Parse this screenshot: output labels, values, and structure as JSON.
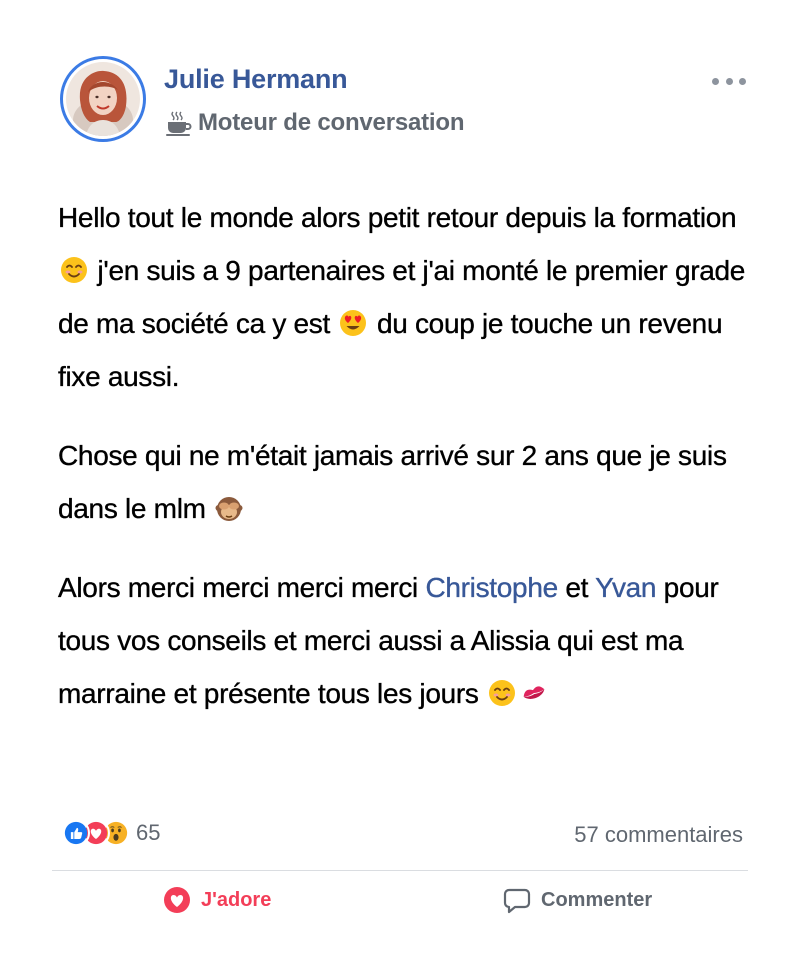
{
  "post": {
    "author": "Julie Hermann",
    "group_name": "Moteur de conversation",
    "group_icon": "coffee-cup-icon",
    "more_icon": "ellipsis-icon",
    "paragraphs": [
      {
        "segments": [
          {
            "text": "Hello tout le monde alors petit retour depuis la formation "
          },
          {
            "emoji": "smiling-face-icon"
          },
          {
            "text": " j'en suis a 9 partenaires et j'ai monté le premier grade de ma société ca y est "
          },
          {
            "emoji": "heart-eyes-face-icon"
          },
          {
            "text": " du coup je touche un revenu fixe aussi."
          }
        ]
      },
      {
        "segments": [
          {
            "text": "Chose qui ne m'était jamais arrivé sur 2 ans que je suis dans le mlm "
          },
          {
            "emoji": "see-no-evil-monkey-icon"
          }
        ]
      },
      {
        "segments": [
          {
            "text": "Alors merci merci merci merci "
          },
          {
            "mention": "Christophe"
          },
          {
            "text": " et "
          },
          {
            "mention": "Yvan"
          },
          {
            "text": " pour tous vos conseils et merci aussi a Alissia qui est ma marraine et présente tous les jours "
          },
          {
            "emoji": "smiling-face-icon"
          },
          {
            "emoji": "kiss-mark-icon"
          }
        ]
      }
    ]
  },
  "stats": {
    "reactions": [
      "like-reaction-icon",
      "love-reaction-icon",
      "wow-reaction-icon"
    ],
    "reaction_count": "65",
    "comments_count": "57 commentaires"
  },
  "actions": {
    "love_label": "J'adore",
    "love_icon": "heart-reaction-icon",
    "comment_label": "Commenter",
    "comment_icon": "speech-bubble-icon"
  },
  "colors": {
    "author": "#385898",
    "mention": "#385898",
    "love": "#f33e58",
    "muted": "#606770",
    "avatar_ring": "#3b7be5"
  }
}
